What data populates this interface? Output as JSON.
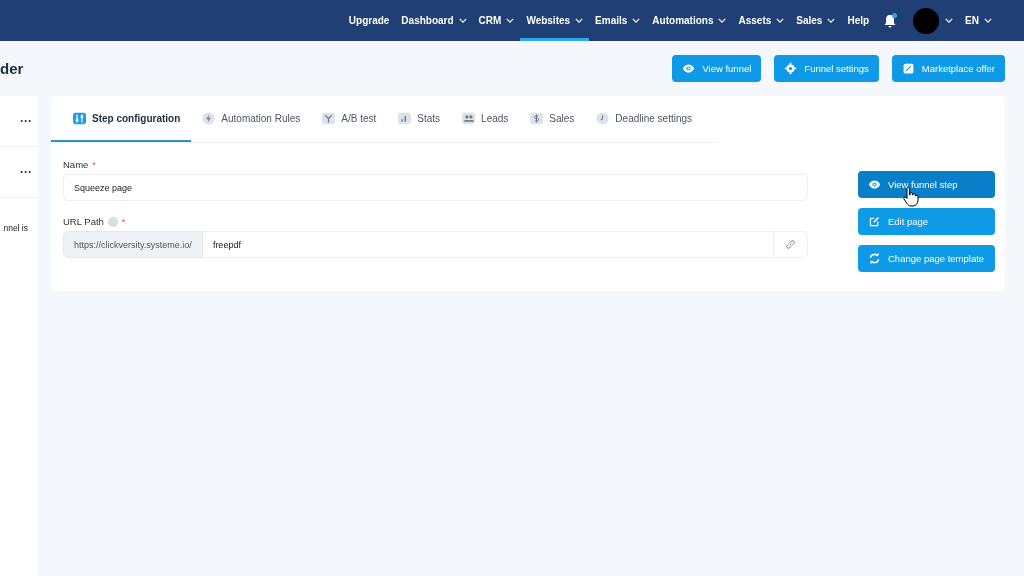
{
  "nav": {
    "items": [
      {
        "label": "Upgrade",
        "dropdown": false,
        "selected": false
      },
      {
        "label": "Dashboard",
        "dropdown": true,
        "selected": false
      },
      {
        "label": "CRM",
        "dropdown": true,
        "selected": false
      },
      {
        "label": "Websites",
        "dropdown": true,
        "selected": true
      },
      {
        "label": "Emails",
        "dropdown": true,
        "selected": false
      },
      {
        "label": "Automations",
        "dropdown": true,
        "selected": false
      },
      {
        "label": "Assets",
        "dropdown": true,
        "selected": false
      },
      {
        "label": "Sales",
        "dropdown": true,
        "selected": false
      },
      {
        "label": "Help",
        "dropdown": false,
        "selected": false
      }
    ],
    "notification": true,
    "language": "EN"
  },
  "page": {
    "title": "der",
    "actions": [
      {
        "label": "View funnel"
      },
      {
        "label": "Funnel settings"
      },
      {
        "label": "Marketplace offer"
      }
    ]
  },
  "sidebar": {
    "items": [
      {
        "kind": "menu",
        "text": "···"
      },
      {
        "kind": "menu",
        "text": "···"
      },
      {
        "kind": "text",
        "text": "nnel is"
      }
    ]
  },
  "tabs": [
    {
      "label": "Step configuration",
      "selected": true
    },
    {
      "label": "Automation Rules",
      "selected": false
    },
    {
      "label": "A/B test",
      "selected": false
    },
    {
      "label": "Stats",
      "selected": false
    },
    {
      "label": "Leads",
      "selected": false
    },
    {
      "label": "Sales",
      "selected": false
    },
    {
      "label": "Deadline settings",
      "selected": false
    }
  ],
  "form": {
    "name": {
      "label": "Name",
      "required_mark": "*",
      "value": "Squeeze page"
    },
    "url_path": {
      "label": "URL Path",
      "required_mark": "*",
      "help": true,
      "prefix": "https://clickversity.systeme.io/",
      "value": "freepdf"
    }
  },
  "step_actions": [
    {
      "label": "View funnel step",
      "hovered": true
    },
    {
      "label": "Edit page",
      "hovered": false
    },
    {
      "label": "Change page template",
      "hovered": false
    }
  ]
}
